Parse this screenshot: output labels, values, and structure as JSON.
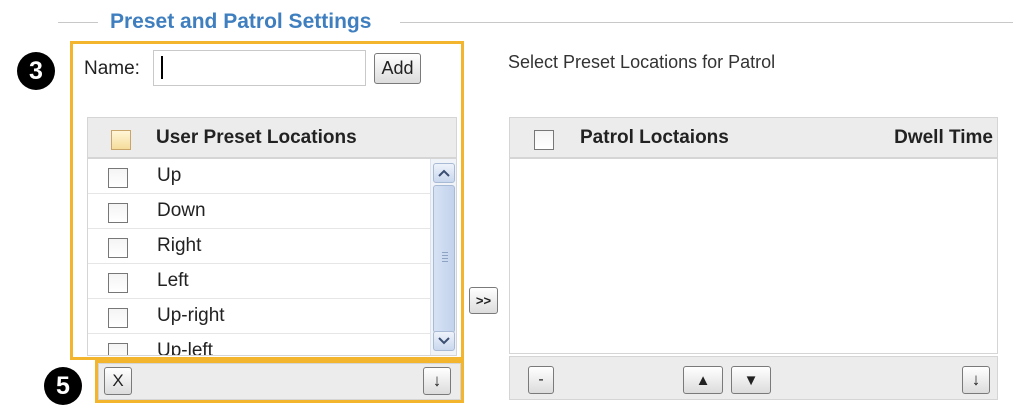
{
  "section": {
    "legend": "Preset and Patrol Settings"
  },
  "callouts": {
    "step3": "3",
    "step5": "5"
  },
  "name_field": {
    "label": "Name:",
    "value": "",
    "add_button": "Add"
  },
  "presets": {
    "header": "User Preset Locations",
    "items": [
      "Up",
      "Down",
      "Right",
      "Left",
      "Up-right",
      "Up-left"
    ],
    "delete_button": "X",
    "sort_button": "↓"
  },
  "transfer_button": ">>",
  "patrol": {
    "hint": "Select Preset Locations for Patrol",
    "header_locations": "Patrol Loctaions",
    "header_dwell": "Dwell Time",
    "items": [],
    "remove_button": "-",
    "up_button": "▲",
    "down_button": "▼",
    "sort_button": "↓"
  },
  "colors": {
    "highlight": "#f2b52d",
    "legend": "#3f7fbf"
  },
  "icons": {
    "scroll_up": "chevron-up-icon",
    "scroll_down": "chevron-down-icon"
  }
}
